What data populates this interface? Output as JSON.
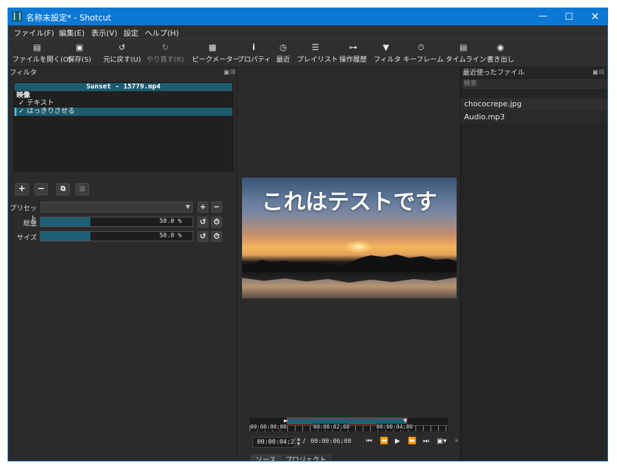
{
  "window": {
    "title": "名称未設定* - Shotcut"
  },
  "menu": {
    "file": "ファイル(F)",
    "edit": "編集(E)",
    "view": "表示(V)",
    "settings": "設定",
    "help": "ヘルプ(H)"
  },
  "toolbar": {
    "open": "ファイルを開く(O)",
    "save": "保存(S)",
    "undo": "元に戻す(U)",
    "redo": "やり直す(R)",
    "peak": "ピークメーター",
    "properties": "プロパティ",
    "recent": "最近",
    "playlist": "プレイリスト",
    "history": "操作履歴",
    "filters": "フィルタ",
    "keyframes": "キーフレーム",
    "timeline": "タイムライン",
    "export": "書き出し"
  },
  "filters_panel": {
    "title": "フィルタ",
    "clip_name": "Sunset - 15779.mp4",
    "group": "映像",
    "items": [
      {
        "check": "✓",
        "label": "テキスト"
      },
      {
        "check": "✓",
        "label": "はっきりさせる"
      }
    ],
    "preset_label": "プリセット",
    "params": [
      {
        "label": "総量",
        "value_text": "50.0 %",
        "value": 0.5
      },
      {
        "label": "サイズ",
        "value_text": "50.0 %",
        "value": 0.5
      }
    ]
  },
  "preview": {
    "overlay_text": "これはテストです"
  },
  "transport": {
    "ticks": [
      "00:00:00;00",
      "00:00:02;00",
      "00:00:04;00"
    ],
    "current": "00:00:04;27",
    "separator": "/",
    "total": "00:00:06;08"
  },
  "tabs": {
    "source": "ソース",
    "project": "プロジェクト"
  },
  "recent_panel": {
    "title": "最近使ったファイル",
    "search_placeholder": "検索",
    "files": [
      "chococrepe.jpg",
      "Audio.mp3"
    ]
  },
  "colors": {
    "accent": "#1d5b6e",
    "titlebar": "#0b78d6",
    "in_out_marker": "#c03030"
  }
}
